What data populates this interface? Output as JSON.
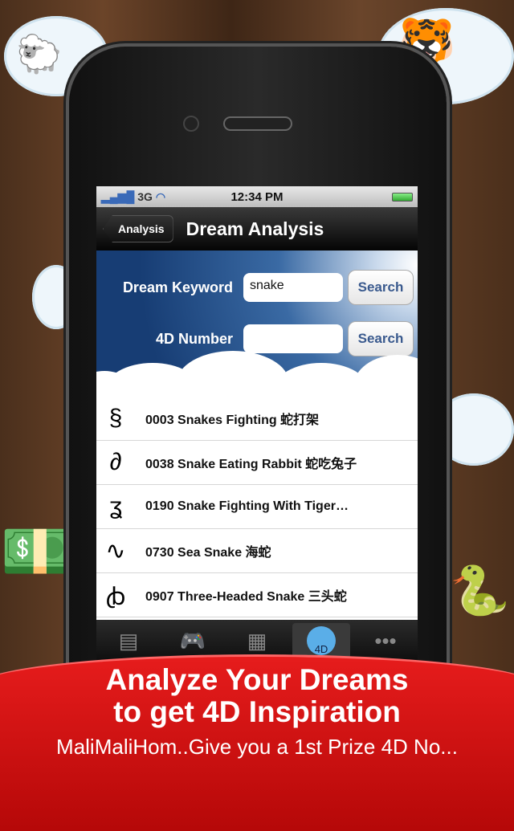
{
  "status": {
    "carrier": "3G",
    "time": "12:34 PM"
  },
  "nav": {
    "back_label": "Analysis",
    "title": "Dream Analysis"
  },
  "search": {
    "keyword_label": "Dream Keyword",
    "keyword_value": "snake",
    "number_label": "4D Number",
    "number_value": "",
    "search_label": "Search"
  },
  "results": [
    {
      "icon": "snakes-fighting-icon",
      "glyph": "§",
      "text": "0003 Snakes Fighting 蛇打架"
    },
    {
      "icon": "snake-rabbit-icon",
      "glyph": "∂",
      "text": "0038 Snake Eating Rabbit 蛇吃兔子"
    },
    {
      "icon": "snake-tiger-icon",
      "glyph": "ʓ",
      "text": "0190 Snake Fighting With Tiger…"
    },
    {
      "icon": "sea-snake-icon",
      "glyph": "∿",
      "text": "0730 Sea Snake 海蛇"
    },
    {
      "icon": "three-headed-snake-icon",
      "glyph": "ꞗ",
      "text": "0907 Three-Headed Snake 三头蛇"
    }
  ],
  "tabs": [
    {
      "icon": "document-icon",
      "glyph": "▤"
    },
    {
      "icon": "gamepad-icon",
      "glyph": "🎮"
    },
    {
      "icon": "calendar-icon",
      "glyph": "▦"
    },
    {
      "icon": "4d-pie-icon",
      "glyph": "4D",
      "selected": true
    },
    {
      "icon": "more-icon",
      "glyph": "•••"
    }
  ],
  "banner": {
    "line1": "Analyze Your Dreams",
    "line2": "to get 4D Inspiration",
    "line3": "MaliMaliHom..Give you a 1st Prize 4D No..."
  },
  "colors": {
    "banner": "#d81010",
    "search_text": "#3a5a8e"
  }
}
